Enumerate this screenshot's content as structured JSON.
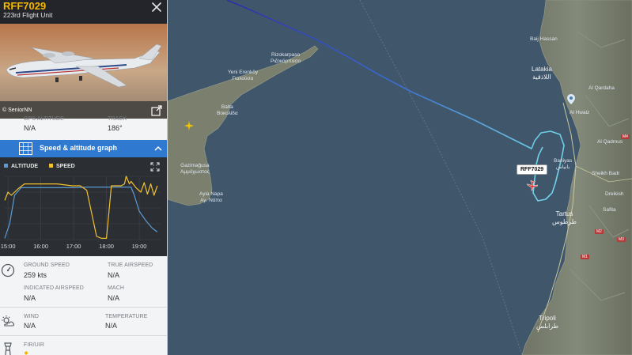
{
  "flight": {
    "callsign": "RFF7029",
    "operator": "223rd Flight Unit",
    "photo_credit": "© SeniorNN",
    "map_tag": "RFF7029"
  },
  "top_stats": {
    "gps_altitude_label": "GPS ALTITUDE",
    "gps_altitude_value": "N/A",
    "track_label": "TRACK",
    "track_value": "186°"
  },
  "graph_section": {
    "title": "Speed & altitude graph",
    "legend_altitude": "ALTITUDE",
    "legend_speed": "SPEED"
  },
  "colors": {
    "altitude": "#5b9bd5",
    "speed": "#f2c12e",
    "callsign": "#f5b800",
    "accent_bar": "#2f7ad0",
    "track_start": "#2d2da8",
    "track_end": "#6fd0e8"
  },
  "chart_data": {
    "type": "line",
    "x_ticks": [
      "15:00",
      "16:00",
      "17:00",
      "18:00",
      "19:00"
    ],
    "xlim": [
      14.9,
      19.65
    ],
    "ylim": [
      0,
      1
    ],
    "series": [
      {
        "name": "ALTITUDE",
        "color": "#5b9bd5",
        "x": [
          14.9,
          15.05,
          15.2,
          15.4,
          17.0,
          17.05,
          17.4,
          18.0,
          18.3,
          18.75,
          18.85,
          19.0,
          19.2,
          19.4,
          19.55
        ],
        "y": [
          0.02,
          0.25,
          0.7,
          0.82,
          0.82,
          0.82,
          0.83,
          0.83,
          0.83,
          0.83,
          0.7,
          0.45,
          0.3,
          0.18,
          0.12
        ]
      },
      {
        "name": "SPEED",
        "color": "#f2c12e",
        "x": [
          14.9,
          15.0,
          15.1,
          15.3,
          15.5,
          16.5,
          16.95,
          17.2,
          17.4,
          17.7,
          17.85,
          18.0,
          18.15,
          18.45,
          18.55,
          18.6,
          18.7,
          18.75,
          18.9,
          19.05,
          19.15,
          19.25,
          19.35,
          19.45,
          19.55
        ],
        "y": [
          0.62,
          0.75,
          0.7,
          0.8,
          0.88,
          0.88,
          0.85,
          0.85,
          0.78,
          0.05,
          0.02,
          0.02,
          0.85,
          0.85,
          0.88,
          1.0,
          0.88,
          0.92,
          0.82,
          0.75,
          0.9,
          0.72,
          0.88,
          0.7,
          0.85
        ]
      }
    ]
  },
  "details": {
    "ground_speed_label": "GROUND SPEED",
    "ground_speed_value": "259 kts",
    "true_airspeed_label": "TRUE AIRSPEED",
    "true_airspeed_value": "N/A",
    "indicated_airspeed_label": "INDICATED AIRSPEED",
    "indicated_airspeed_value": "N/A",
    "mach_label": "MACH",
    "mach_value": "N/A",
    "wind_label": "WIND",
    "wind_value": "N/A",
    "temperature_label": "TEMPERATURE",
    "temperature_value": "N/A",
    "fir_label": "FIR/UIR"
  },
  "map_labels": {
    "rizokarpaso": "Rizokarpaso\nΡιζοκάρπασο",
    "yenierenkoy": "Yeni Erenköy\nΓιαλούσα",
    "balta": "Balta\nΒοκολίδα",
    "gazimagusa": "Gazimağusa\nΑμμόχωστος",
    "ayianapa": "Ayia Napa\nΑγ. Νάπα",
    "latakia": "Latakia\nاللاذقية",
    "baniyas": "Baniyas\nبانياس",
    "tartus": "Tartus\nطرطوس",
    "tripoli": "Tripoli\nطرابلس",
    "alhwaiz": "Al Hwaiz",
    "alqardaha": "Al Qardaha",
    "baijhassan": "Baij Hassan",
    "sheikhbader": "Sheikh Badr",
    "safita": "Safita",
    "dreikish": "Dreikish",
    "alqadmus": "Al Qadmus"
  },
  "map_roads": {
    "m1": "M1",
    "m2": "M2",
    "m3": "M3",
    "m4": "M4"
  },
  "icons": {
    "close": "close-icon",
    "expand_photo": "expand-icon",
    "graph": "graph-icon",
    "chevron": "chevron-up-icon",
    "chart_expand": "fullscreen-icon",
    "speed": "speedometer-icon",
    "wind": "weather-icon",
    "fir": "tower-icon",
    "aircraft": "aircraft-icon",
    "pin": "location-pin-icon",
    "airport": "airport-icon"
  }
}
